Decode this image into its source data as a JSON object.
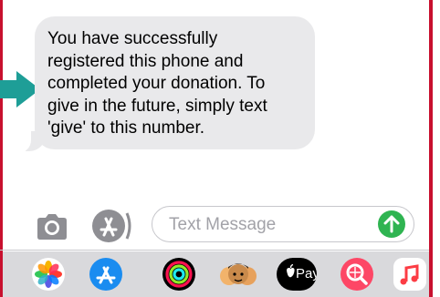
{
  "colors": {
    "frame": "#c8102e",
    "bubble": "#e9e9eb",
    "arrow": "#1e9e97",
    "send": "#2fb451",
    "drawer": "#d9d9dc"
  },
  "message": {
    "text": "You have successfully\nregistered this phone and\ncompleted your donation.  To\ngive in the future, simply text\n'give' to this number."
  },
  "composer": {
    "placeholder": "Text Message",
    "camera_icon": "camera-icon",
    "apps_icon": "app-store-icon",
    "send_icon": "arrow-up-icon"
  },
  "app_drawer": {
    "apps": [
      {
        "icon": "photos-icon"
      },
      {
        "icon": "app-store-icon"
      },
      {
        "icon": "activity-icon"
      },
      {
        "icon": "memoji-icon"
      },
      {
        "icon": "apple-pay-icon",
        "label": "Pay"
      },
      {
        "icon": "search-images-icon"
      },
      {
        "icon": "music-icon"
      }
    ]
  }
}
